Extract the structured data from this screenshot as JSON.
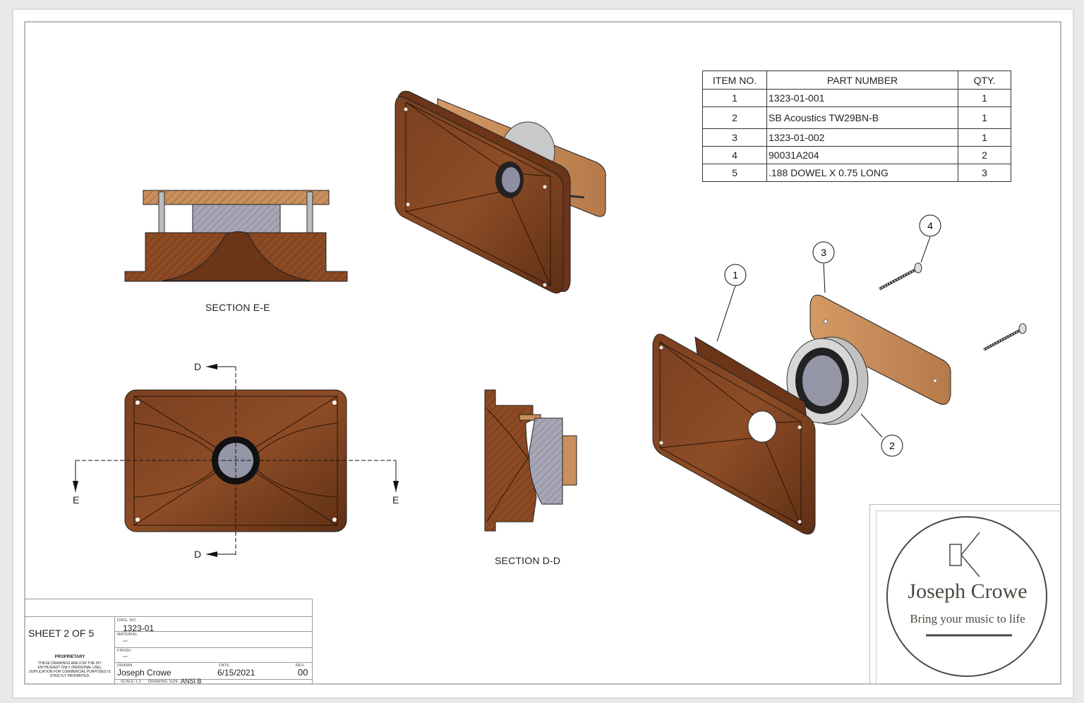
{
  "views": {
    "section_ee_label": "SECTION E-E",
    "section_dd_label": "SECTION D-D",
    "cut_marker_d": "D",
    "cut_marker_e": "E"
  },
  "bom": {
    "headers": [
      "ITEM NO.",
      "PART NUMBER",
      "QTY."
    ],
    "rows": [
      [
        "1",
        "1323-01-001",
        "1"
      ],
      [
        "2",
        "SB Acoustics TW29BN-B",
        "1"
      ],
      [
        "3",
        "1323-01-002",
        "1"
      ],
      [
        "4",
        "90031A204",
        "2"
      ],
      [
        "5",
        ".188 DOWEL X 0.75 LONG",
        "3"
      ]
    ]
  },
  "balloons": [
    "1",
    "2",
    "3",
    "4"
  ],
  "title_block": {
    "sheet": "SHEET 2 OF 5",
    "dwg_no_label": "DWG. NO.",
    "dwg_no": "1323-01",
    "material_label": "MATERIAL",
    "material": "--",
    "finish_label": "FINISH",
    "finish": "--",
    "drawn_label": "DRAWN",
    "drawn": "Joseph Crowe",
    "date_label": "DATE",
    "date": "6/15/2021",
    "rev_label": "REV.",
    "rev": "00",
    "scale": "SCALE:1:2",
    "drawing_size_label": "DRAWING SIZE",
    "drawing_size": "ANSI B",
    "proprietary_title": "PROPRIETARY",
    "proprietary_text": "THESE DRAWINGS ARE FOR THE DIY ENTHUSIAST ONLY (PERSONAL USE). DUPLICATION FOR COMMERCIAL PURPOSES IS STRICTLY PROHIBITED."
  },
  "logo": {
    "name": "Joseph Crowe",
    "tagline": "Bring your music to life"
  },
  "colors": {
    "wood_dark": "#6e3a1c",
    "wood_light": "#c98f5c",
    "metal": "#9a9aab",
    "line": "#1a1a1a",
    "logo": "#4a4a42"
  }
}
